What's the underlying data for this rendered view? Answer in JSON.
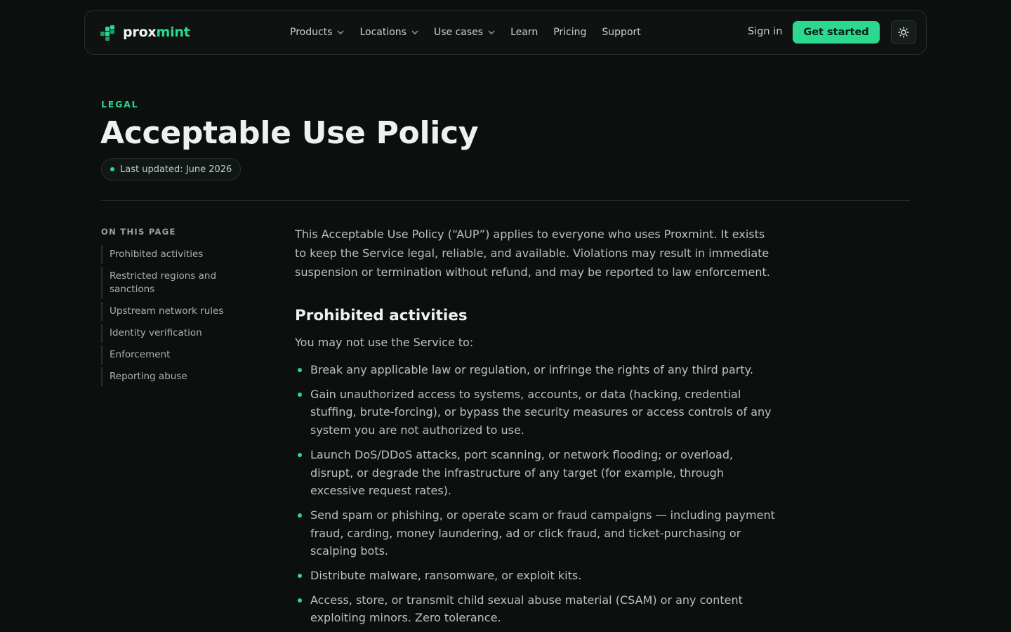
{
  "brand": {
    "name_part1": "prox",
    "name_part2": "mint",
    "logo_icon": "proxmint-logo-icon"
  },
  "nav": {
    "links": [
      {
        "label": "Products",
        "has_dropdown": true
      },
      {
        "label": "Locations",
        "has_dropdown": true
      },
      {
        "label": "Use cases",
        "has_dropdown": true
      },
      {
        "label": "Learn",
        "has_dropdown": false
      },
      {
        "label": "Pricing",
        "has_dropdown": false
      },
      {
        "label": "Support",
        "has_dropdown": false
      }
    ],
    "sign_in": "Sign in",
    "cta": "Get started",
    "theme_icon": "sun-icon"
  },
  "header": {
    "eyebrow": "LEGAL",
    "title": "Acceptable Use Policy",
    "updated": "Last updated: June 2026"
  },
  "toc": {
    "title": "ON THIS PAGE",
    "items": [
      "Prohibited activities",
      "Restricted regions and sanctions",
      "Upstream network rules",
      "Identity verification",
      "Enforcement",
      "Reporting abuse"
    ]
  },
  "content": {
    "intro": "This Acceptable Use Policy (“AUP”) applies to everyone who uses Proxmint. It exists to keep the Service legal, reliable, and available. Violations may result in immediate suspension or termination without refund, and may be reported to law enforcement.",
    "section_title": "Prohibited activities",
    "lead": "You may not use the Service to:",
    "items": [
      "Break any applicable law or regulation, or infringe the rights of any third party.",
      "Gain unauthorized access to systems, accounts, or data (hacking, credential stuffing, brute-forcing), or bypass the security measures or access controls of any system you are not authorized to use.",
      "Launch DoS/DDoS attacks, port scanning, or network flooding; or overload, disrupt, or degrade the infrastructure of any target (for example, through excessive request rates).",
      "Send spam or phishing, or operate scam or fraud campaigns — including payment fraud, carding, money laundering, ad or click fraud, and ticket-purchasing or scalping bots.",
      "Distribute malware, ransomware, or exploit kits.",
      "Access, store, or transmit child sexual abuse material (CSAM) or any content exploiting minors. Zero tolerance."
    ]
  },
  "colors": {
    "accent": "#2bd88f",
    "background": "#0b0f0e",
    "text": "#e8ece9",
    "muted": "#b9c2be"
  }
}
